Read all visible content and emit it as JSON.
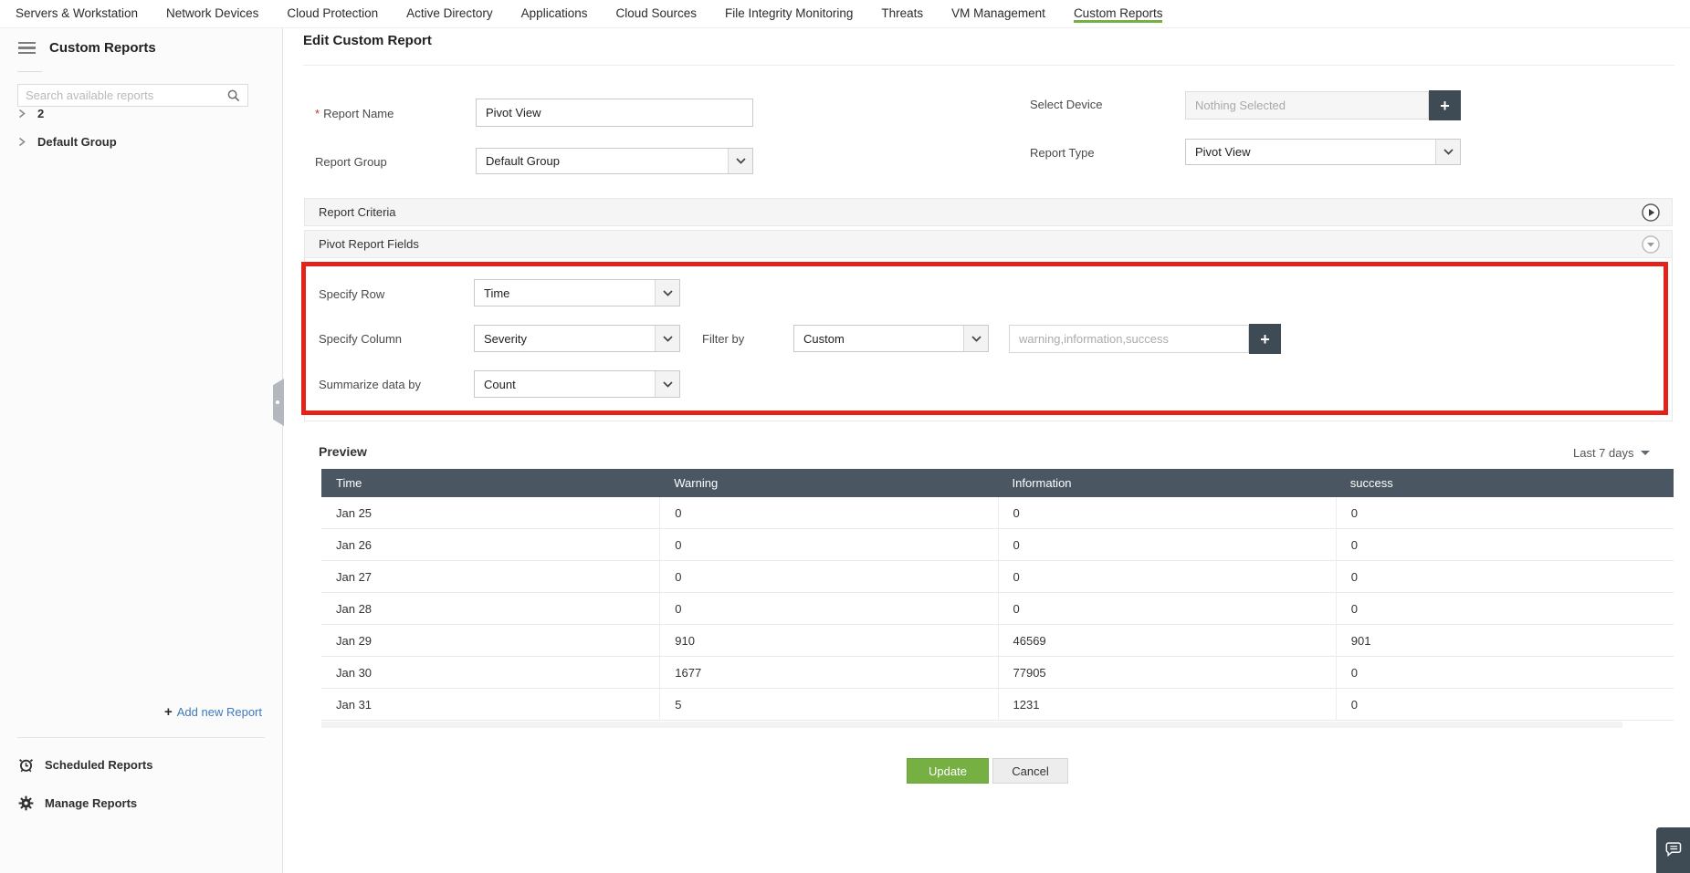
{
  "nav": {
    "items": [
      {
        "label": "Servers & Workstation"
      },
      {
        "label": "Network Devices"
      },
      {
        "label": "Cloud Protection"
      },
      {
        "label": "Active Directory"
      },
      {
        "label": "Applications"
      },
      {
        "label": "Cloud Sources"
      },
      {
        "label": "File Integrity Monitoring"
      },
      {
        "label": "Threats"
      },
      {
        "label": "VM Management"
      },
      {
        "label": "Custom Reports"
      }
    ]
  },
  "sidebar": {
    "title": "Custom Reports",
    "search": {
      "placeholder": "Search available reports"
    },
    "tree": [
      {
        "label": "2"
      },
      {
        "label": "Default Group"
      }
    ],
    "add_report": {
      "plus": "+",
      "label": "Add new Report"
    },
    "scheduled_reports": "Scheduled Reports",
    "manage_reports": "Manage Reports"
  },
  "main": {
    "title": "Edit Custom Report",
    "form": {
      "report_name": {
        "required_mark": "*",
        "label": "Report Name",
        "value": "Pivot View"
      },
      "report_group": {
        "label": "Report Group",
        "value": "Default Group"
      },
      "select_device": {
        "label": "Select Device",
        "value": "Nothing Selected",
        "add_label": "+"
      },
      "report_type": {
        "label": "Report Type",
        "value": "Pivot View"
      }
    },
    "sections": {
      "report_criteria": "Report Criteria",
      "pivot_report_fields": "Pivot Report Fields"
    },
    "pivot": {
      "specify_row": {
        "label": "Specify Row",
        "value": "Time"
      },
      "specify_column": {
        "label": "Specify Column",
        "value": "Severity"
      },
      "filter_by": {
        "label": "Filter by",
        "value": "Custom"
      },
      "filter_values": {
        "value": "warning,information,success",
        "add_label": "+"
      },
      "summarize": {
        "label": "Summarize data by",
        "value": "Count"
      }
    },
    "preview": {
      "title": "Preview",
      "date_range": "Last 7 days",
      "table": {
        "columns": [
          "Time",
          "Warning",
          "Information",
          "success"
        ],
        "rows": [
          [
            "Jan 25",
            "0",
            "0",
            "0"
          ],
          [
            "Jan 26",
            "0",
            "0",
            "0"
          ],
          [
            "Jan 27",
            "0",
            "0",
            "0"
          ],
          [
            "Jan 28",
            "0",
            "0",
            "0"
          ],
          [
            "Jan 29",
            "910",
            "46569",
            "901"
          ],
          [
            "Jan 30",
            "1677",
            "77905",
            "0"
          ],
          [
            "Jan 31",
            "5",
            "1231",
            "0"
          ]
        ]
      }
    },
    "actions": {
      "update": "Update",
      "cancel": "Cancel"
    }
  },
  "colors": {
    "accent_green": "#76b043",
    "dark_slate": "#3e4a54",
    "table_header": "#4a5661",
    "annotation_red": "#e2231a",
    "link_blue": "#3e79c0"
  }
}
